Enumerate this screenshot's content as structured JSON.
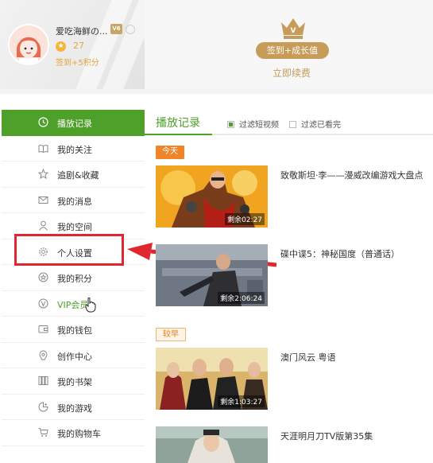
{
  "profile": {
    "username": "爱吃海鲜の...",
    "vip_badge": "V6",
    "points": "27",
    "sign_bonus": "签到+5积分"
  },
  "vip_panel": {
    "sign_button": "签到+成长值",
    "renew_link": "立即续费",
    "accent_color": "#c79b58"
  },
  "sidebar": {
    "items": [
      {
        "label": "播放记录",
        "icon": "clock-icon"
      },
      {
        "label": "我的关注",
        "icon": "book-open-icon"
      },
      {
        "label": "追剧&收藏",
        "icon": "star-icon"
      },
      {
        "label": "我的消息",
        "icon": "envelope-icon"
      },
      {
        "label": "我的空间",
        "icon": "person-icon"
      },
      {
        "label": "个人设置",
        "icon": "gear-icon"
      },
      {
        "label": "我的积分",
        "icon": "medal-icon"
      },
      {
        "label": "VIP会员",
        "icon": "vip-icon"
      },
      {
        "label": "我的钱包",
        "icon": "wallet-icon"
      },
      {
        "label": "创作中心",
        "icon": "creator-icon"
      },
      {
        "label": "我的书架",
        "icon": "bookshelf-icon"
      },
      {
        "label": "我的游戏",
        "icon": "game-icon"
      },
      {
        "label": "我的购物车",
        "icon": "cart-icon"
      }
    ],
    "active_color": "#4fa02a"
  },
  "main": {
    "title": "播放记录",
    "filter_short": "过滤短视频",
    "filter_watched": "过滤已看完",
    "today_label": "今天",
    "earlier_label": "较早",
    "videos": [
      {
        "title": "致敬斯坦·李——漫威改编游戏大盘点",
        "remain": "剩余02:27"
      },
      {
        "title": "碟中谍5：神秘国度（普通话）",
        "remain": "剩余2:06:24"
      },
      {
        "title": "澳门风云 粤语",
        "remain": "剩余1:03:27"
      },
      {
        "title": "天涯明月刀TV版第35集",
        "remain": ""
      }
    ]
  }
}
